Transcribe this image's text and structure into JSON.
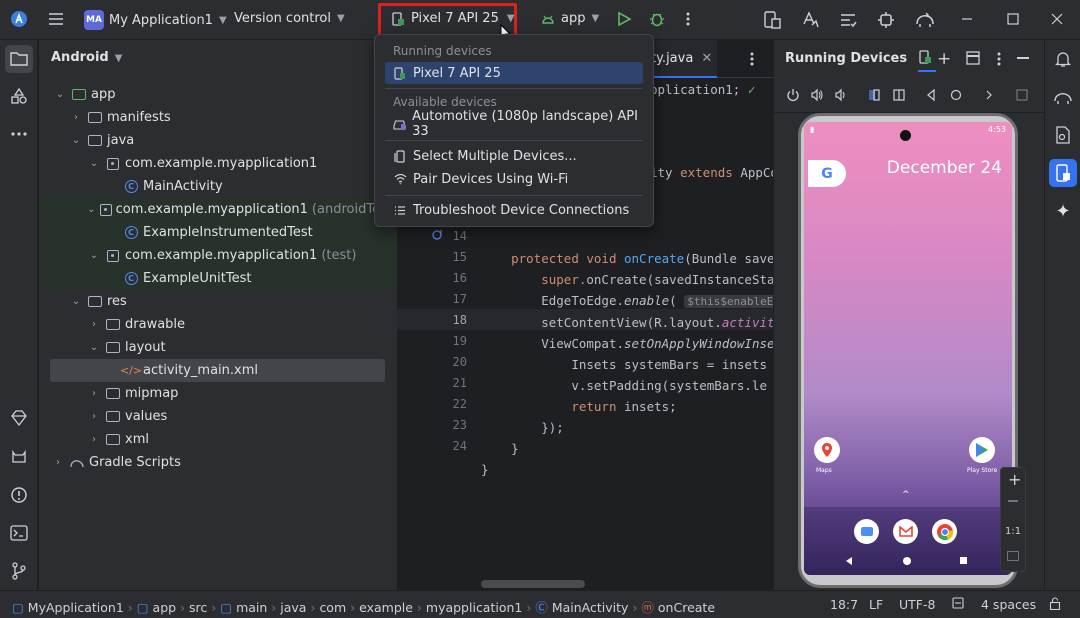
{
  "titlebar": {
    "project_badge": "MA",
    "project_name": "My Application1",
    "version_control": "Version control",
    "device": "Pixel 7 API 25",
    "run_config": "app"
  },
  "project_panel": {
    "title": "Android",
    "tree": [
      {
        "label": "app",
        "extra": ""
      },
      {
        "label": "manifests",
        "extra": ""
      },
      {
        "label": "java",
        "extra": ""
      },
      {
        "label": "com.example.myapplication1",
        "extra": ""
      },
      {
        "label": "MainActivity",
        "extra": ""
      },
      {
        "label": "com.example.myapplication1",
        "extra": "(androidTest)"
      },
      {
        "label": "ExampleInstrumentedTest",
        "extra": ""
      },
      {
        "label": "com.example.myapplication1",
        "extra": "(test)"
      },
      {
        "label": "ExampleUnitTest",
        "extra": ""
      },
      {
        "label": "res",
        "extra": ""
      },
      {
        "label": "drawable",
        "extra": ""
      },
      {
        "label": "layout",
        "extra": ""
      },
      {
        "label": "activity_main.xml",
        "extra": ""
      },
      {
        "label": "mipmap",
        "extra": ""
      },
      {
        "label": "values",
        "extra": ""
      },
      {
        "label": "xml",
        "extra": ""
      },
      {
        "label": "Gradle Scripts",
        "extra": ""
      }
    ]
  },
  "editor": {
    "tab_label": "ty.java",
    "lines": [
      "14",
      "15",
      "16",
      "17",
      "18",
      "19",
      "20",
      "21",
      "22",
      "23",
      "24"
    ],
    "code": {
      "l0a": "pplication1;",
      "l3a": "ity ",
      "l3b": "extends",
      "l3c": " AppCo",
      "l14a": "protected void ",
      "l14b": "onCreate",
      "l14c": "(Bundle save",
      "l15a": "super.",
      "l15b": "onCreate",
      "l15c": "(savedInstanceSta",
      "l16a": "EdgeToEdge.",
      "l16b": "enable",
      "l16c": "( ",
      "l16d": "$this$enableEdg",
      "l17a": "setContentView(R.layout.",
      "l17b": "activit",
      "l18a": "ViewCompat.",
      "l18b": "setOnApplyWindowInse",
      "l19": "Insets systemBars = insets",
      "l20": "v.setPadding(systemBars.le",
      "l21a": "return",
      "l21b": " insets;",
      "l22": "});",
      "l23": "}",
      "l24": "}"
    }
  },
  "dropdown": {
    "running_header": "Running devices",
    "running_item": "Pixel 7 API 25",
    "available_header": "Available devices",
    "available_item": "Automotive (1080p landscape) API 33",
    "select_multiple": "Select Multiple Devices...",
    "pair_wifi": "Pair Devices Using Wi-Fi",
    "troubleshoot": "Troubleshoot Device Connections"
  },
  "running_devices": {
    "title": "Running Devices",
    "zoom_label": "1:1",
    "phone": {
      "time": "4:53",
      "date": "December 24",
      "google_letter": "G",
      "app_maps": "Maps",
      "app_play": "Play Store"
    }
  },
  "statusbar": {
    "crumbs": [
      "MyApplication1",
      "app",
      "src",
      "main",
      "java",
      "com",
      "example",
      "myapplication1",
      "MainActivity",
      "onCreate"
    ],
    "position": "18:7",
    "line_sep": "LF",
    "encoding": "UTF-8",
    "indent": "4 spaces"
  }
}
